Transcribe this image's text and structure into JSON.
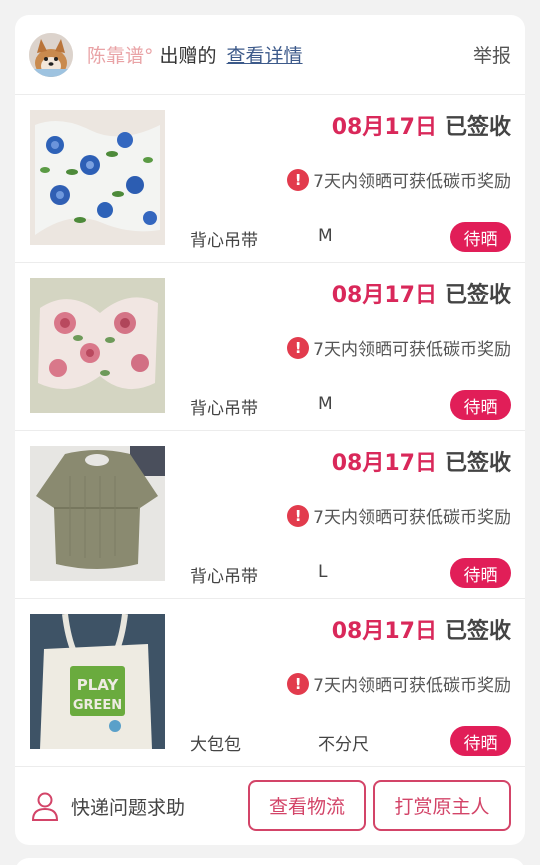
{
  "header": {
    "donor_name": "陈靠谱°",
    "donor_suffix": "出赠的",
    "details_link": "查看详情",
    "report": "举报"
  },
  "items": [
    {
      "date": "08月17日",
      "status": "已签收",
      "notice": "7天内领晒可获低碳币奖励",
      "name": "背心吊带",
      "size": "M",
      "badge": "待晒"
    },
    {
      "date": "08月17日",
      "status": "已签收",
      "notice": "7天内领晒可获低碳币奖励",
      "name": "背心吊带",
      "size": "M",
      "badge": "待晒"
    },
    {
      "date": "08月17日",
      "status": "已签收",
      "notice": "7天内领晒可获低碳币奖励",
      "name": "背心吊带",
      "size": "L",
      "badge": "待晒"
    },
    {
      "date": "08月17日",
      "status": "已签收",
      "notice": "7天内领晒可获低碳币奖励",
      "name": "大包包",
      "size": "不分尺",
      "badge": "待晒",
      "bag_print": [
        "PLAY",
        "GREEN"
      ]
    }
  ],
  "footer": {
    "help_text": "快递问题求助",
    "logistics_button": "查看物流",
    "tip_button": "打赏原主人"
  },
  "colors": {
    "accent": "#e11e58",
    "date": "#d9285a",
    "donor": "#e9a3a6",
    "link": "#3d5a8a",
    "warning": "#e23b4d"
  },
  "icons": {
    "warning": "exclamation-circle-icon",
    "help": "person-outline-icon"
  }
}
